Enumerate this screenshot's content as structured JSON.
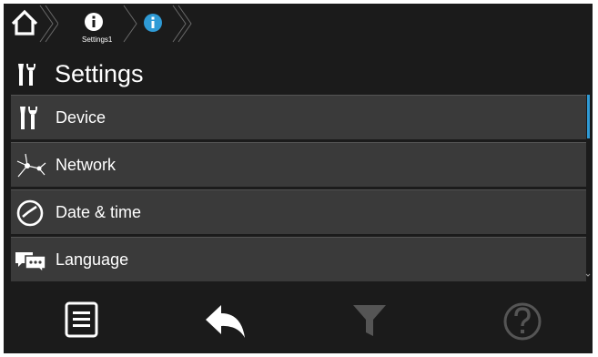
{
  "breadcrumb": {
    "items": [
      {
        "icon": "home-icon"
      },
      {
        "icon": "info-icon",
        "label": "Settings1"
      },
      {
        "icon": "info-icon-active"
      }
    ]
  },
  "header": {
    "icon": "wrench-screwdriver-icon",
    "title": "Settings"
  },
  "menu": {
    "items": [
      {
        "icon": "wrench-screwdriver-icon",
        "label": "Device"
      },
      {
        "icon": "network-icon",
        "label": "Network"
      },
      {
        "icon": "clock-icon",
        "label": "Date & time"
      },
      {
        "icon": "chat-bubbles-icon",
        "label": "Language"
      }
    ]
  },
  "toolbar": {
    "buttons": [
      {
        "icon": "list-icon",
        "enabled": true
      },
      {
        "icon": "back-arrow-icon",
        "enabled": true
      },
      {
        "icon": "filter-icon",
        "enabled": false
      },
      {
        "icon": "help-icon",
        "enabled": false
      }
    ]
  },
  "colors": {
    "background": "#1b1b1b",
    "item_background": "#3a3a3a",
    "accent": "#2f9bd6",
    "text": "#ffffff",
    "disabled": "#555555"
  }
}
